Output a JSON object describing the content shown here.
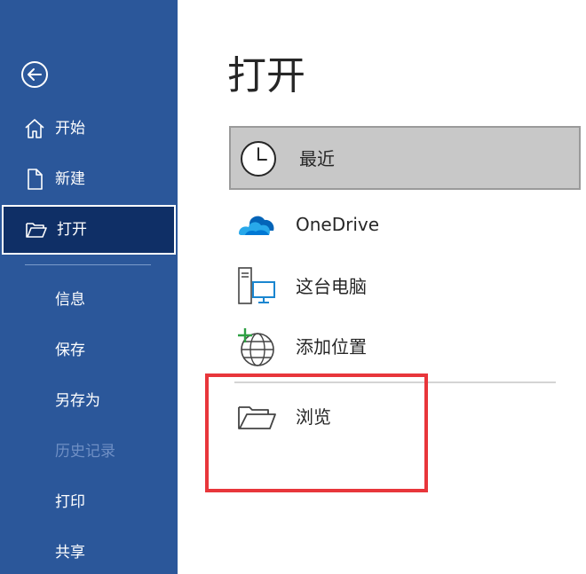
{
  "sidebar": {
    "back_icon": "back-arrow-icon",
    "primary_items": [
      {
        "label": "开始",
        "icon": "home-icon"
      },
      {
        "label": "新建",
        "icon": "new-document-icon"
      },
      {
        "label": "打开",
        "icon": "open-folder-icon",
        "active": true
      }
    ],
    "secondary_items": [
      {
        "label": "信息",
        "enabled": true
      },
      {
        "label": "保存",
        "enabled": true
      },
      {
        "label": "另存为",
        "enabled": true
      },
      {
        "label": "历史记录",
        "enabled": false
      },
      {
        "label": "打印",
        "enabled": true
      },
      {
        "label": "共享",
        "enabled": true
      }
    ]
  },
  "main": {
    "title": "打开",
    "locations": [
      {
        "label": "最近",
        "icon": "clock-icon",
        "selected": true
      },
      {
        "label": "OneDrive",
        "icon": "cloud-icon"
      },
      {
        "label": "这台电脑",
        "icon": "computer-icon"
      },
      {
        "label": "添加位置",
        "icon": "globe-add-icon"
      },
      {
        "label": "浏览",
        "icon": "folder-open-icon"
      }
    ]
  },
  "colors": {
    "sidebar_bg": "#2b579a",
    "active_item_bg": "#0f2f66",
    "highlight_border": "#e8363b",
    "selected_location_bg": "#c8c8c8"
  }
}
